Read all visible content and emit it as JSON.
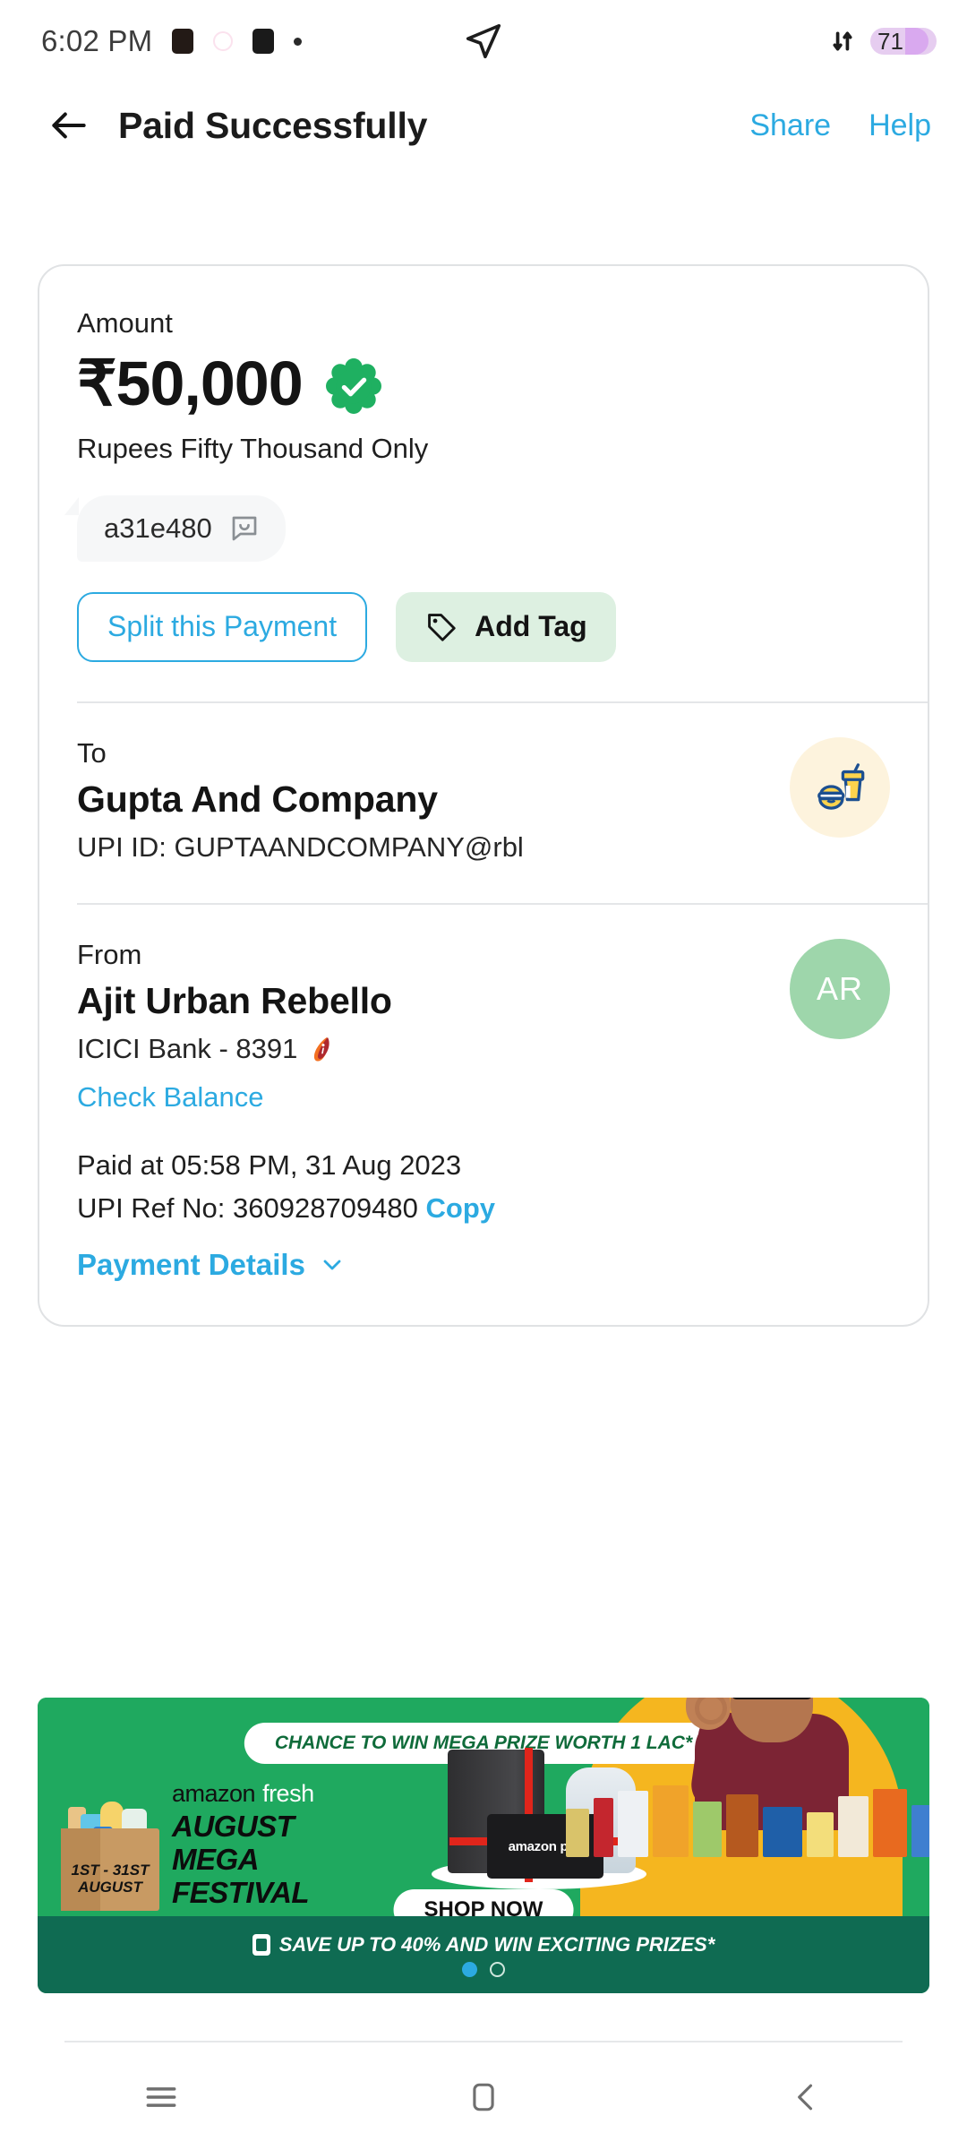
{
  "status_bar": {
    "time": "6:02 PM",
    "battery_percent": "71",
    "icons": [
      "notification-icon",
      "notification-icon-2",
      "notification-icon-3",
      "notification-dot",
      "location-arrow-icon",
      "data-transfer-icon",
      "battery-icon"
    ]
  },
  "header": {
    "back_icon": "back-arrow-icon",
    "title": "Paid Successfully",
    "share_label": "Share",
    "help_label": "Help"
  },
  "receipt": {
    "amount_label": "Amount",
    "amount": "₹50,000",
    "amount_words": "Rupees Fifty Thousand Only",
    "note": "a31e480",
    "note_icon": "chat-bubble-smiley-icon",
    "success_icon": "green-verified-check-icon",
    "split_button": "Split this Payment",
    "add_tag_button": "Add Tag",
    "add_tag_icon": "tag-icon",
    "to": {
      "label": "To",
      "name": "Gupta And Company",
      "upi_id": "UPI ID: GUPTAANDCOMPANY@rbl",
      "avatar_icon": "food-and-drink-icon"
    },
    "from": {
      "label": "From",
      "name": "Ajit Urban Rebello",
      "bank": "ICICI Bank - 8391",
      "bank_logo_icon": "icici-bank-logo-icon",
      "check_balance": "Check Balance",
      "avatar_initials": "AR"
    },
    "paid_at": "Paid at 05:58 PM, 31 Aug 2023",
    "upi_ref": "UPI Ref No: 360928709480",
    "copy_label": "Copy",
    "payment_details": "Payment Details",
    "payment_details_icon": "chevron-down-icon"
  },
  "ad": {
    "pill": "CHANCE TO WIN MEGA PRIZE WORTH 1 LAC*",
    "brand_amazon": "amazon",
    "brand_fresh": "fresh",
    "title_line1": "AUGUST",
    "title_line2": "MEGA",
    "title_line3": "FESTIVAL",
    "date_line1": "1ST - 31ST",
    "date_line2": "AUGUST",
    "gift_card_label": "amazon pay",
    "cta": "SHOP NOW",
    "strip": "SAVE UP TO 40% AND WIN EXCITING PRIZES*",
    "carousel": {
      "total": 2,
      "active": 1
    }
  },
  "nav": {
    "recents_icon": "recents-menu-icon",
    "home_icon": "home-square-icon",
    "back_icon": "back-chevron-icon"
  },
  "colors": {
    "accent_blue": "#2caae1",
    "success_green": "#1fb061",
    "tag_green_bg": "#ddf0e1",
    "ad_green": "#1fa95f",
    "ad_strip": "#0f6b52"
  }
}
